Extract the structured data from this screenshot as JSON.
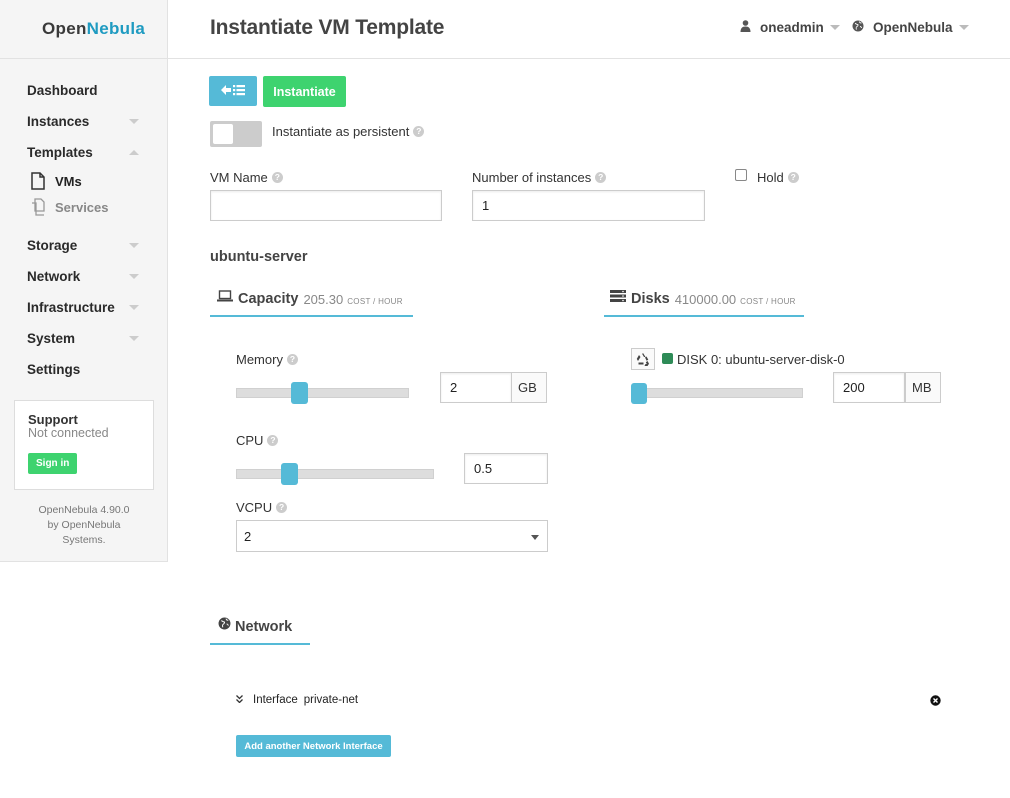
{
  "brand": {
    "part1": "Open",
    "part2": "Nebula"
  },
  "header": {
    "title": "Instantiate VM Template",
    "user": "oneadmin",
    "zone": "OpenNebula"
  },
  "sidebar": {
    "items": [
      {
        "label": "Dashboard"
      },
      {
        "label": "Instances"
      },
      {
        "label": "Templates"
      },
      {
        "label": "VMs"
      },
      {
        "label": "Services"
      },
      {
        "label": "Storage"
      },
      {
        "label": "Network"
      },
      {
        "label": "Infrastructure"
      },
      {
        "label": "System"
      },
      {
        "label": "Settings"
      }
    ],
    "support": {
      "title": "Support",
      "status": "Not connected",
      "signin": "Sign in"
    },
    "version": {
      "line1": "OpenNebula 4.90.0",
      "line2": "by OpenNebula",
      "line3": "Systems."
    }
  },
  "toolbar": {
    "instantiate_label": "Instantiate",
    "persistent_label": "Instantiate as persistent"
  },
  "form": {
    "vm_name_label": "VM Name",
    "vm_name_value": "",
    "instances_label": "Number of instances",
    "instances_value": "1",
    "hold_label": "Hold"
  },
  "template": {
    "name": "ubuntu-server"
  },
  "capacity": {
    "title": "Capacity",
    "cost": "205.30",
    "cost_unit": "COST / HOUR",
    "memory_label": "Memory",
    "memory_value": "2",
    "memory_unit": "GB",
    "memory_slider_fraction": 0.35,
    "cpu_label": "CPU",
    "cpu_value": "0.5",
    "cpu_slider_fraction": 0.25,
    "vcpu_label": "VCPU",
    "vcpu_value": "2"
  },
  "disks": {
    "title": "Disks",
    "cost": "410000.00",
    "cost_unit": "COST / HOUR",
    "disk_label": "DISK 0: ubuntu-server-disk-0",
    "disk_value": "200",
    "disk_unit": "MB",
    "disk_slider_fraction": 0.0
  },
  "network": {
    "title": "Network",
    "interface_label": "Interface",
    "interface_name": "private-net",
    "add_label": "Add another Network Interface"
  },
  "colors": {
    "accent": "#55bad7",
    "success": "#3ed36f",
    "brand": "#1f9bc1",
    "disk_swatch": "#2e8b57"
  },
  "icons": [
    "arrow-left-list-icon",
    "user-icon",
    "globe-icon",
    "file-icon",
    "files-icon",
    "laptop-icon",
    "server-icon",
    "recycle-icon",
    "chevron-double-down-icon",
    "close-circle-icon",
    "help-icon"
  ]
}
